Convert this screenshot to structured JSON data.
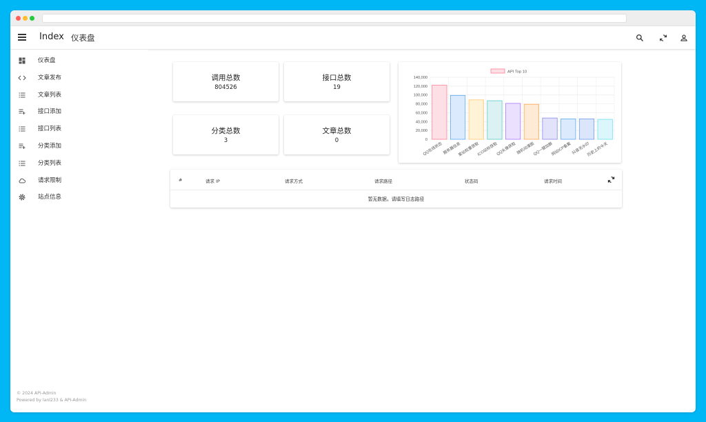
{
  "app": {
    "title": "Index",
    "page_title": "仪表盘"
  },
  "appbar_icons": [
    "search-icon",
    "refresh-icon",
    "account-icon"
  ],
  "sidebar": {
    "items": [
      {
        "label": "仪表盘",
        "icon": "dashboard-icon"
      },
      {
        "label": "文章发布",
        "icon": "code-icon"
      },
      {
        "label": "文章列表",
        "icon": "list-icon"
      },
      {
        "label": "接口添加",
        "icon": "playlist-add-icon"
      },
      {
        "label": "接口列表",
        "icon": "list-icon"
      },
      {
        "label": "分类添加",
        "icon": "playlist-add-icon"
      },
      {
        "label": "分类列表",
        "icon": "list-icon"
      },
      {
        "label": "请求限制",
        "icon": "cloud-icon"
      },
      {
        "label": "站点信息",
        "icon": "gear-icon"
      }
    ]
  },
  "footer": {
    "line1": "© 2024 API-Admin",
    "line2": "Powered by lanl233 & API-Admin"
  },
  "stats": [
    {
      "label": "调用总数",
      "value": "804526"
    },
    {
      "label": "接口总数",
      "value": "19"
    },
    {
      "label": "分类总数",
      "value": "3"
    },
    {
      "label": "文章总数",
      "value": "0"
    }
  ],
  "chart_data": {
    "type": "bar",
    "legend": "API Top 10",
    "legend_position": "top",
    "categories": [
      "QQ在线状态",
      "服务器信息",
      "爱站权重获取",
      "ICO站标获取",
      "QQ头像获取",
      "随机动漫图",
      "QQ一键加群",
      "网站ICP备案",
      "抖音无水印",
      "历史上的今天"
    ],
    "values": [
      122000,
      99000,
      89000,
      87000,
      81000,
      79000,
      48000,
      46000,
      46000,
      45000
    ],
    "ylim": [
      0,
      140000
    ],
    "yticks": [
      "0",
      "20,000",
      "40,000",
      "60,000",
      "80,000",
      "100,000",
      "120,000",
      "140,000"
    ],
    "grid": true,
    "fill_colors": [
      "#fde0e6",
      "#dbeafd",
      "#fff2d6",
      "#dcf2f2",
      "#ebe0fd",
      "#ffead6",
      "#e2e2fb",
      "#dbeafd",
      "#dbe6fb",
      "#dbf7fc"
    ],
    "stroke_colors": [
      "#ff7f97",
      "#5aa9f2",
      "#ffc970",
      "#5ccaca",
      "#a878ff",
      "#ffaa55",
      "#8a8ae8",
      "#5aa9f2",
      "#6f9ef0",
      "#6ee0f0"
    ]
  },
  "table": {
    "columns": [
      "#",
      "请求 IP",
      "请求方式",
      "请求路径",
      "状态码",
      "请求时间"
    ],
    "empty_message": "暂无数据，请填写日志路径"
  }
}
